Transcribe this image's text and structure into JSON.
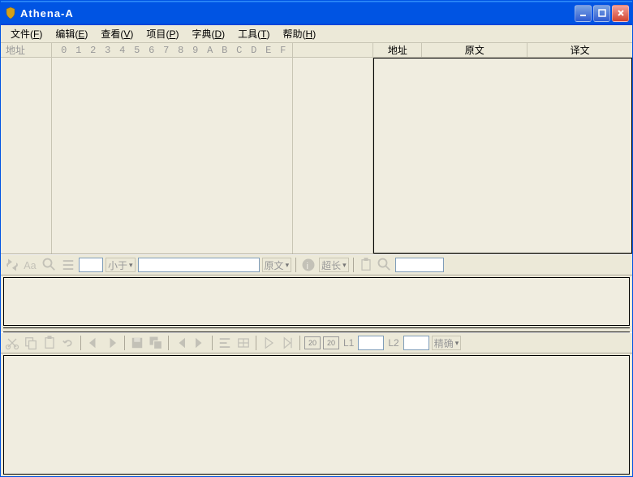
{
  "title": "Athena-A",
  "menu": [
    {
      "label": "文件",
      "accel": "F"
    },
    {
      "label": "编辑",
      "accel": "E"
    },
    {
      "label": "查看",
      "accel": "V"
    },
    {
      "label": "项目",
      "accel": "P"
    },
    {
      "label": "字典",
      "accel": "D"
    },
    {
      "label": "工具",
      "accel": "T"
    },
    {
      "label": "帮助",
      "accel": "H"
    }
  ],
  "hex": {
    "addr_label": "地址",
    "cols": [
      "0",
      "1",
      "2",
      "3",
      "4",
      "5",
      "6",
      "7",
      "8",
      "9",
      "A",
      "B",
      "C",
      "D",
      "E",
      "F"
    ]
  },
  "table": {
    "col_addr": "地址",
    "col_src": "原文",
    "col_dst": "译文"
  },
  "toolbar1": {
    "lessthan": "小于",
    "srctext": "原文",
    "overlong": "超长"
  },
  "toolbar2": {
    "badge20a": "20",
    "badge20b": "20",
    "l1": "L1",
    "l2": "L2",
    "exact": "精确"
  }
}
